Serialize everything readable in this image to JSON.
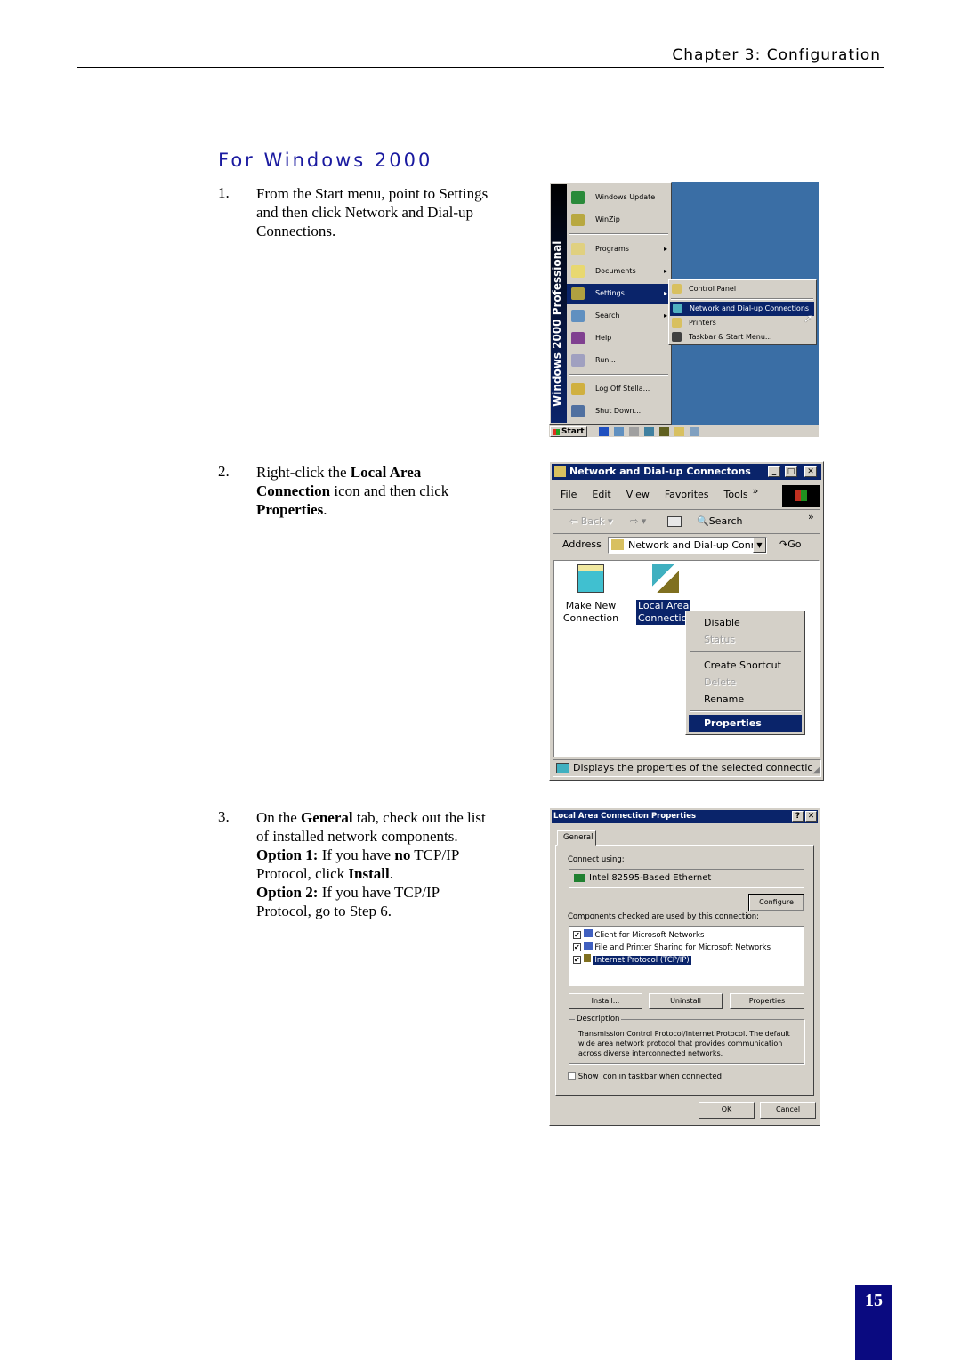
{
  "header": {
    "chapter": "Chapter 3: Configuration"
  },
  "section_title": "For Windows 2000",
  "steps": [
    {
      "number": "1.",
      "lines": [
        "From the Start menu, point to Settings",
        "and then click Network and Dial-up",
        "Connections."
      ]
    },
    {
      "number": "2.",
      "parts": {
        "a": "Right-click the ",
        "b": "Local Area",
        "c": "Connection",
        "d": " icon and then click",
        "e": "Properties",
        "f": "."
      }
    },
    {
      "number": "3.",
      "parts": {
        "a": "On the ",
        "b": "General",
        "c": " tab, check out the list",
        "d": "of installed network components.",
        "e": "Option 1:",
        "f": " If you have ",
        "g": "no",
        "h": " TCP/IP",
        "i": "Protocol, click ",
        "j": "Install",
        "k": ".",
        "l": "Option 2:",
        "m": " If you have TCP/IP",
        "n": "Protocol, go to Step 6."
      }
    }
  ],
  "start_menu": {
    "banner": "Windows 2000 Professional",
    "items": [
      {
        "label": "Windows Update",
        "icon": "globe-icon"
      },
      {
        "label": "WinZip",
        "icon": "winzip-icon"
      },
      {
        "label": "Programs",
        "icon": "programs-icon",
        "submenu": true
      },
      {
        "label": "Documents",
        "icon": "folder-icon",
        "submenu": true
      },
      {
        "label": "Settings",
        "icon": "settings-icon",
        "submenu": true,
        "selected": true
      },
      {
        "label": "Search",
        "icon": "search-icon",
        "submenu": true
      },
      {
        "label": "Help",
        "icon": "help-icon"
      },
      {
        "label": "Run...",
        "icon": "run-icon"
      },
      {
        "label": "Log Off Stella...",
        "icon": "key-icon"
      },
      {
        "label": "Shut Down...",
        "icon": "shutdown-icon"
      }
    ],
    "settings_submenu": [
      "Control Panel",
      "Network and Dial-up Connections",
      "Printers",
      "Taskbar & Start Menu..."
    ],
    "start_button": "Start",
    "desktop_color": "#3a6ea5"
  },
  "explorer": {
    "title": "Network and Dial-up Connectons",
    "menu": [
      "File",
      "Edit",
      "View",
      "Favorites",
      "Tools"
    ],
    "more": "»",
    "toolbar": {
      "back": "Back",
      "search": "Search"
    },
    "address_label": "Address",
    "address_value": "Network and Dial-up Conn",
    "go": "Go",
    "icons": [
      {
        "line1": "Make New",
        "line2": "Connection"
      },
      {
        "line1": "Local Area",
        "line2": "Connectio"
      }
    ],
    "context_menu": [
      {
        "label": "Disable",
        "enabled": true
      },
      {
        "label": "Status",
        "enabled": false
      },
      {
        "label": "Create Shortcut",
        "enabled": true
      },
      {
        "label": "Delete",
        "enabled": false
      },
      {
        "label": "Rename",
        "enabled": true
      },
      {
        "label": "Properties",
        "enabled": true,
        "selected": true
      }
    ],
    "status": "Displays the properties of the selected connectic"
  },
  "properties": {
    "title": "Local Area Connection Properties",
    "tab": "General",
    "connect_using_label": "Connect using:",
    "adapter": "Intel 82595-Based Ethernet",
    "configure": "Configure",
    "components_label": "Components checked are used by this connection:",
    "components": [
      {
        "label": "Client for Microsoft Networks",
        "checked": true
      },
      {
        "label": "File and Printer Sharing for Microsoft Networks",
        "checked": true
      },
      {
        "label": "Internet Protocol (TCP/IP)",
        "checked": true,
        "selected": true
      }
    ],
    "buttons": [
      "Install...",
      "Uninstall",
      "Properties"
    ],
    "description_label": "Description",
    "description": "Transmission Control Protocol/Internet Protocol. The default wide area network protocol that provides communication across diverse interconnected networks.",
    "show_icon": "Show icon in taskbar when connected",
    "show_icon_checked": false,
    "ok": "OK",
    "cancel": "Cancel"
  },
  "page_number": "15",
  "colors": {
    "title_blue": "#1a1aa0",
    "win_navy": "#0a246a",
    "page_box": "#0a0a80"
  }
}
